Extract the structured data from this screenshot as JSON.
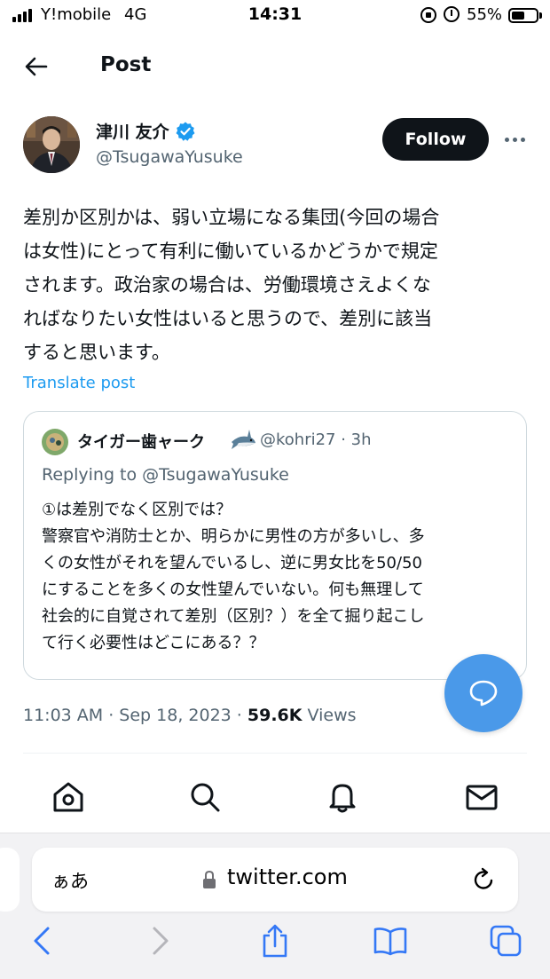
{
  "status_bar": {
    "carrier": "Y!mobile",
    "network": "4G",
    "time": "14:31",
    "battery_percent": "55%",
    "battery_level": 0.55
  },
  "header": {
    "title": "Post"
  },
  "author": {
    "name": "津川 友介",
    "handle": "@TsugawaYusuke",
    "verified": true
  },
  "follow_label": "Follow",
  "tweet": {
    "text": "差別か区別かは、弱い立場になる集団(今回の場合\nは女性)にとって有利に働いているかどうかで規定\nされます。政治家の場合は、労働環境さえよくな\nればなりたい女性はいると思うので、差別に該当\nすると思います。",
    "translate_label": "Translate post"
  },
  "quote": {
    "name": "タイガー歯ャーク",
    "meta": "@kohri27 · 3h",
    "reply_to": "Replying to @TsugawaYusuke",
    "text": "①は差別でなく区別では？\n警察官や消防士とか、明らかに男性の方が多いし、多\nくの女性がそれを望んでいるし、逆に男女比を50/50\nにすることを多くの女性望んでいない。何も無理して\n社会的に自覚されて差別（区別？）を全て掘り起こし\nて行く必要性はどこにある？？"
  },
  "meta": {
    "timestamp": "11:03 AM · Sep 18, 2023 · ",
    "views_count": "59.6K",
    "views_label": " Views"
  },
  "safari": {
    "aa": "ぁあ",
    "url": "twitter.com"
  },
  "colors": {
    "accent": "#1d9bf0",
    "fab": "#4a99e9",
    "text_primary": "#0f1419",
    "text_secondary": "#536471"
  }
}
